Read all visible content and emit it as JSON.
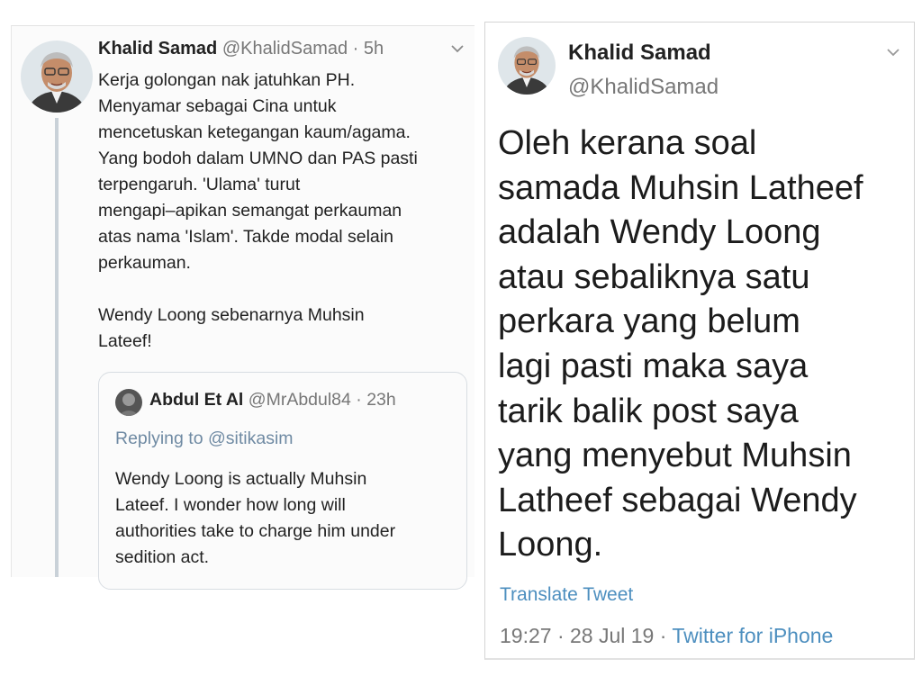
{
  "left_tweet": {
    "name": "Khalid Samad",
    "meta": "@KhalidSamad · 5h",
    "lines": [
      "Kerja golongan nak jatuhkan PH.",
      "Menyamar sebagai Cina untuk",
      "mencetuskan ketegangan kaum/agama.",
      "Yang bodoh dalam UMNO dan PAS pasti",
      "terpengaruh. 'Ulama' turut",
      "mengapi–apikan semangat perkauman",
      "atas nama 'Islam'. Takde modal  selain",
      "perkauman."
    ],
    "lines2": [
      "Wendy Loong sebenarnya Muhsin",
      "Lateef!"
    ],
    "quoted": {
      "name": "Abdul Et Al",
      "meta": "@MrAbdul84 · 23h",
      "replying": "Replying to @sitikasim",
      "lines": [
        "Wendy Loong is actually Muhsin",
        "Lateef. I wonder how long will",
        "authorities take to charge him under",
        "sedition act."
      ]
    }
  },
  "right_tweet": {
    "name": "Khalid Samad",
    "handle": "@KhalidSamad",
    "lines": [
      "Oleh kerana soal",
      "samada Muhsin Latheef",
      "adalah Wendy Loong",
      "atau sebaliknya satu",
      "perkara yang belum",
      "lagi pasti maka saya",
      "tarik balik post saya",
      "yang menyebut Muhsin",
      "Latheef sebagai Wendy",
      "Loong."
    ],
    "translate": "Translate Tweet",
    "timestamp": "19:27 · 28 Jul 19 · ",
    "source": "Twitter for iPhone"
  },
  "colors": {
    "link_blue": "#4d8fbf",
    "muted_gray": "#777777",
    "thread_line": "#c9d1d8"
  },
  "icons": {
    "avatar": "portrait-avatar",
    "caret": "chevron-down-icon"
  }
}
